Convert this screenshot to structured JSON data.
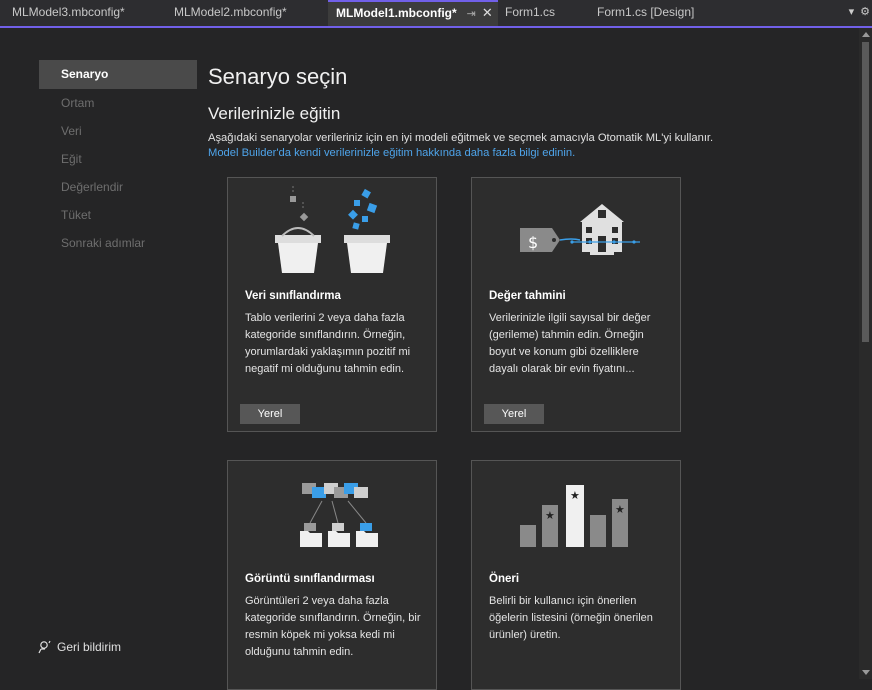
{
  "tabs": [
    {
      "label": "MLModel3.mbconfig*"
    },
    {
      "label": "MLModel2.mbconfig*"
    },
    {
      "label": "MLModel1.mbconfig*"
    },
    {
      "label": "Form1.cs"
    },
    {
      "label": "Form1.cs [Design]"
    }
  ],
  "nav": {
    "items": [
      {
        "label": "Senaryo"
      },
      {
        "label": "Ortam"
      },
      {
        "label": "Veri"
      },
      {
        "label": "Eğit"
      },
      {
        "label": "Değerlendir"
      },
      {
        "label": "Tüket"
      },
      {
        "label": "Sonraki adımlar"
      }
    ],
    "feedback": "Geri bildirim"
  },
  "main": {
    "title": "Senaryo seçin",
    "subtitle": "Verilerinizle eğitin",
    "description": "Aşağıdaki senaryolar verileriniz için en iyi modeli eğitmek ve seçmek amacıyla Otomatik ML'yi kullanır.",
    "link": "Model Builder'da kendi verilerinizle eğitim hakkında daha fazla bilgi edinin."
  },
  "cards": [
    {
      "title": "Veri sınıflandırma",
      "description": "Tablo verilerini 2 veya daha fazla kategoride sınıflandırın. Örneğin, yorumlardaki yaklaşımın pozitif mi negatif mi olduğunu tahmin edin.",
      "button": "Yerel",
      "icon": "buckets-icon"
    },
    {
      "title": "Değer tahmini",
      "description": "Verilerinizle ilgili sayısal bir değer (gerileme) tahmin edin. Örneğin boyut ve konum gibi özelliklere dayalı olarak bir evin fiyatını...",
      "button": "Yerel",
      "icon": "house-price-icon"
    },
    {
      "title": "Görüntü sınıflandırması",
      "description": "Görüntüleri 2 veya daha fazla kategoride sınıflandırın. Örneğin, bir resmin köpek mi yoksa kedi mi olduğunu tahmin edin.",
      "icon": "image-folders-icon"
    },
    {
      "title": "Öneri",
      "description": "Belirli bir kullanıcı için önerilen öğelerin listesini (örneğin önerilen ürünler) üretin.",
      "icon": "star-bars-icon"
    }
  ],
  "colors": {
    "accent": "#7160e8",
    "link": "#4ea4ea",
    "icon_blue": "#3a9ee8",
    "background": "#252526"
  }
}
